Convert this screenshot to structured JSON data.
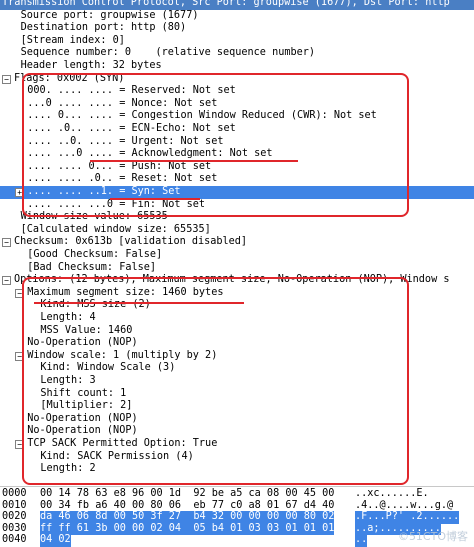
{
  "tree": [
    {
      "text": "Transmission Control Protocol, Src Port: groupwise (1677), Dst Port: http",
      "indent": 0,
      "expander": "",
      "style": "sel-top"
    },
    {
      "text": "Source port: groupwise (1677)",
      "indent": 2
    },
    {
      "text": "Destination port: http (80)",
      "indent": 2
    },
    {
      "text": "[Stream index: 0]",
      "indent": 2
    },
    {
      "text": "Sequence number: 0    (relative sequence number)",
      "indent": 2
    },
    {
      "text": "Header length: 32 bytes",
      "indent": 2
    },
    {
      "text": "Flags: 0x002 (SYN)",
      "indent": 1,
      "expander": "−"
    },
    {
      "text": "000. .... .... = Reserved: Not set",
      "indent": 3
    },
    {
      "text": "...0 .... .... = Nonce: Not set",
      "indent": 3
    },
    {
      "text": ".... 0... .... = Congestion Window Reduced (CWR): Not set",
      "indent": 3
    },
    {
      "text": ".... .0.. .... = ECN-Echo: Not set",
      "indent": 3
    },
    {
      "text": ".... ..0. .... = Urgent: Not set",
      "indent": 3
    },
    {
      "text": ".... ...0 .... = Acknowledgment: Not set",
      "indent": 3
    },
    {
      "text": ".... .... 0... = Push: Not set",
      "indent": 3
    },
    {
      "text": ".... .... .0.. = Reset: Not set",
      "indent": 3
    },
    {
      "text": ".... .... ..1. = Syn: Set",
      "indent": 3,
      "expander": "+",
      "style": "sel"
    },
    {
      "text": ".... .... ...0 = Fin: Not set",
      "indent": 3
    },
    {
      "text": "Window size value: 65535",
      "indent": 2
    },
    {
      "text": "[Calculated window size: 65535]",
      "indent": 2
    },
    {
      "text": "Checksum: 0x613b [validation disabled]",
      "indent": 1,
      "expander": "−"
    },
    {
      "text": "[Good Checksum: False]",
      "indent": 3
    },
    {
      "text": "[Bad Checksum: False]",
      "indent": 3
    },
    {
      "text": "Options: (12 bytes), Maximum segment size, No-Operation (NOP), Window s",
      "indent": 1,
      "expander": "−"
    },
    {
      "text": "Maximum segment size: 1460 bytes",
      "indent": 3,
      "expander": "−"
    },
    {
      "text": "Kind: MSS size (2)",
      "indent": 5
    },
    {
      "text": "Length: 4",
      "indent": 5
    },
    {
      "text": "MSS Value: 1460",
      "indent": 5
    },
    {
      "text": "No-Operation (NOP)",
      "indent": 3
    },
    {
      "text": "Window scale: 1 (multiply by 2)",
      "indent": 3,
      "expander": "−"
    },
    {
      "text": "Kind: Window Scale (3)",
      "indent": 5
    },
    {
      "text": "Length: 3",
      "indent": 5
    },
    {
      "text": "Shift count: 1",
      "indent": 5
    },
    {
      "text": "[Multiplier: 2]",
      "indent": 5
    },
    {
      "text": "No-Operation (NOP)",
      "indent": 3
    },
    {
      "text": "No-Operation (NOP)",
      "indent": 3
    },
    {
      "text": "TCP SACK Permitted Option: True",
      "indent": 3,
      "expander": "−"
    },
    {
      "text": "Kind: SACK Permission (4)",
      "indent": 5
    },
    {
      "text": "Length: 2",
      "indent": 5
    }
  ],
  "hex": [
    {
      "offset": "0000",
      "bytes": "00 14 78 63 e8 96 00 1d  92 be a5 ca 08 00 45 00",
      "ascii": "..xc......E.",
      "hl_from": -1
    },
    {
      "offset": "0010",
      "bytes": "00 34 fb a6 40 00 80 06  eb 77 c0 a8 01 67 d4 40",
      "ascii": ".4..@....w...g.@",
      "hl_from": -1
    },
    {
      "offset": "0020",
      "bytes": "da 46 06 8d 00 50 3f 27  b4 32 00 00 00 00 80 02",
      "ascii": ".F...P?' .2......",
      "hl_from": 2
    },
    {
      "offset": "0030",
      "bytes": "ff ff 61 3b 00 00 02 04  05 b4 01 03 03 01 01 01",
      "ascii": "..a;..........",
      "hl_from": 0
    },
    {
      "offset": "0040",
      "bytes": "04 02",
      "ascii": "..",
      "hl_from": 0
    }
  ],
  "watermark": "©51CTO博客"
}
